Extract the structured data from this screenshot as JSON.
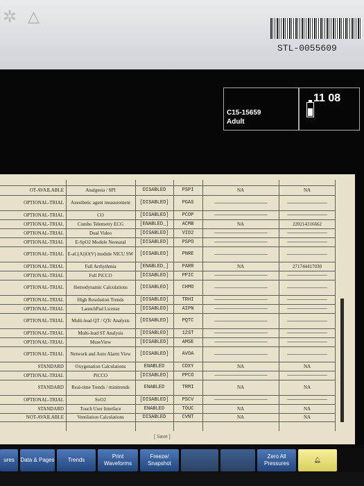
{
  "device": {
    "serial": "STL-0055609"
  },
  "header": {
    "bed": "C15-15659",
    "category": "Adult",
    "time": "11 08",
    "battery_level": 0.6
  },
  "licenses": {
    "rows": [
      {
        "status": "",
        "feature": "",
        "state": "",
        "code": "",
        "col5": "",
        "col6": ""
      },
      {
        "status": "OT-AVAILABLE",
        "feature": "Analgesia / SPI",
        "state": "DISABLED",
        "code": "PSPI",
        "col5": "NA",
        "col6": "NA"
      },
      {
        "status": "OPTIONAL-TRIAL",
        "feature": "Anesthetic agent measurement",
        "state": "[DISABLED]",
        "code": "PGAS",
        "col5": "",
        "col6": ""
      },
      {
        "status": "OPTIONAL-TRIAL",
        "feature": "CO",
        "state": "[DISABLED]",
        "code": "PCOP",
        "col5": "",
        "col6": ""
      },
      {
        "status": "OPTIONAL-TRIAL",
        "feature": "Combo Telemetry ECG",
        "state": "[ENABLED_]",
        "code": "ACMB",
        "col5": "NA",
        "col6": "220214316662"
      },
      {
        "status": "OPTIONAL-TRIAL",
        "feature": "Dual Video",
        "state": "[DISABLED]",
        "code": "VID2",
        "col5": "",
        "col6": ""
      },
      {
        "status": "OPTIONAL-TRIAL",
        "feature": "E-SpO2 Module Neonatal",
        "state": "[DISABLED]",
        "code": "PSPO",
        "col5": "",
        "col6": ""
      },
      {
        "status": "OPTIONAL-TRIAL",
        "feature": "E-aC(Ai)O(V) module NICU SW",
        "state": "[DISABLED]",
        "code": "PNRE",
        "col5": "",
        "col6": ""
      },
      {
        "status": "OPTIONAL-TRIAL",
        "feature": "Full Arrhythmia",
        "state": "[ENABLED_]",
        "code": "PARR",
        "col5": "NA",
        "col6": "271744417030"
      },
      {
        "status": "OPTIONAL-TRIAL",
        "feature": "Full PiCCO",
        "state": "[DISABLED]",
        "code": "PPIC",
        "col5": "",
        "col6": ""
      },
      {
        "status": "OPTIONAL-TRIAL",
        "feature": "Hemodynamic Calculations",
        "state": "[DISABLED]",
        "code": "CHMO",
        "col5": "",
        "col6": ""
      },
      {
        "status": "OPTIONAL-TRIAL",
        "feature": "High Resolution Trends",
        "state": "[DISABLED]",
        "code": "TRHI",
        "col5": "",
        "col6": ""
      },
      {
        "status": "OPTIONAL-TRIAL",
        "feature": "LaunchPad License",
        "state": "[DISABLED]",
        "code": "AIPN",
        "col5": "",
        "col6": ""
      },
      {
        "status": "OPTIONAL-TRIAL",
        "feature": "Multi-lead QT / QTc Analysis",
        "state": "[DISABLED]",
        "code": "PQTC",
        "col5": "",
        "col6": ""
      },
      {
        "status": "OPTIONAL-TRIAL",
        "feature": "Multi-lead ST Analysis",
        "state": "[DISABLED]",
        "code": "12ST",
        "col5": "",
        "col6": ""
      },
      {
        "status": "OPTIONAL-TRIAL",
        "feature": "MuseView",
        "state": "[DISABLED]",
        "code": "AMSE",
        "col5": "",
        "col6": ""
      },
      {
        "status": "OPTIONAL-TRIAL",
        "feature": "Network and Auto Alarm View",
        "state": "[DISABLED]",
        "code": "AVOA",
        "col5": "",
        "col6": ""
      },
      {
        "status": "STANDARD",
        "feature": "Oxygenation Calculations",
        "state": "ENABLED",
        "code": "COXY",
        "col5": "NA",
        "col6": "NA"
      },
      {
        "status": "OPTIONAL-TRIAL",
        "feature": "PiCCO",
        "state": "[DISABLED]",
        "code": "PPCO",
        "col5": "",
        "col6": ""
      },
      {
        "status": "STANDARD",
        "feature": "Real-time Trends / minitrends",
        "state": "ENABLED",
        "code": "TRMI",
        "col5": "NA",
        "col6": "NA"
      },
      {
        "status": "OPTIONAL-TRIAL",
        "feature": "SvO2",
        "state": "[DISABLED]",
        "code": "PSCV",
        "col5": "",
        "col6": ""
      },
      {
        "status": "STANDARD",
        "feature": "Touch User Interface",
        "state": "ENABLED",
        "code": "TOUC",
        "col5": "NA",
        "col6": "NA"
      },
      {
        "status": "NOT-AVAILABLE",
        "feature": "Ventilation Calculations",
        "state": "DISABLED",
        "code": "CVNT",
        "col5": "NA",
        "col6": "NA"
      }
    ]
  },
  "save_label": "[ Save ]",
  "softkeys": [
    {
      "label": "ures"
    },
    {
      "label": "Data & Pages"
    },
    {
      "label": "Trends"
    },
    {
      "label": "Print Waveforms"
    },
    {
      "label": "Freeze/ Snapshot"
    },
    {
      "label": ""
    },
    {
      "label": ""
    },
    {
      "label": "Zero All Pressures"
    },
    {
      "label": "alarm-bell-icon"
    }
  ]
}
